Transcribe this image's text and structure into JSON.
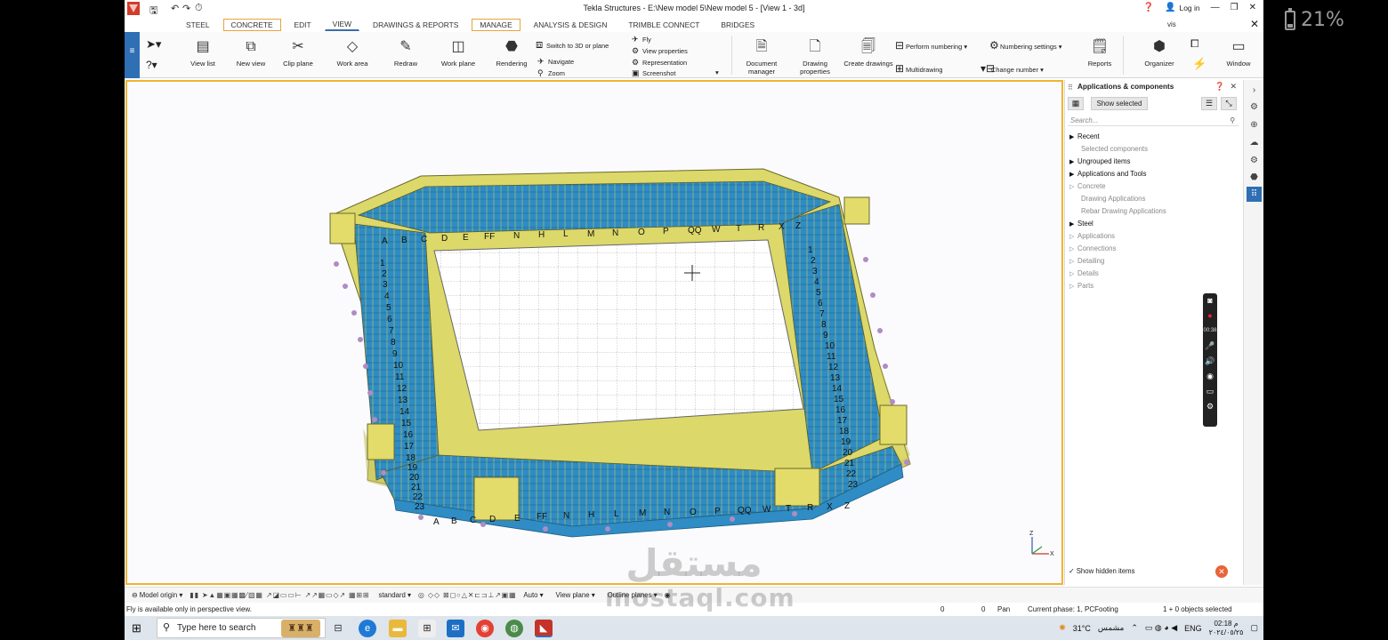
{
  "phone_status": {
    "battery": "21%"
  },
  "window": {
    "title": "Tekla Structures - E:\\New model 5\\New model 5 - [View 1 - 3d]",
    "login": "Log in",
    "search_value": "vis"
  },
  "menu_tabs": [
    {
      "label": "STEEL"
    },
    {
      "label": "CONCRETE"
    },
    {
      "label": "EDIT"
    },
    {
      "label": "VIEW"
    },
    {
      "label": "DRAWINGS & REPORTS"
    },
    {
      "label": "MANAGE"
    },
    {
      "label": "ANALYSIS & DESIGN"
    },
    {
      "label": "TRIMBLE CONNECT"
    },
    {
      "label": "BRIDGES"
    }
  ],
  "ribbon": {
    "view_list": "View list",
    "new_view": "New view",
    "clip_plane": "Clip plane",
    "work_area": "Work area",
    "redraw": "Redraw",
    "work_plane": "Work plane",
    "rendering": "Rendering",
    "switch_3d": "Switch to 3D or plane",
    "navigate": "Navigate",
    "zoom": "Zoom",
    "fly": "Fly",
    "view_properties": "View properties",
    "representation": "Representation",
    "screenshot": "Screenshot",
    "document_manager": "Document manager",
    "drawing_properties": "Drawing properties",
    "create_drawings": "Create drawings",
    "perform_numbering": "Perform numbering",
    "multidrawing": "Multidrawing",
    "numbering_settings": "Numbering settings",
    "change_number": "Change number",
    "reports": "Reports",
    "organizer": "Organizer",
    "window": "Window"
  },
  "model": {
    "grid_x_top": [
      "A",
      "B",
      "C",
      "D",
      "E",
      "FF",
      "N",
      "H",
      "L",
      "M",
      "N",
      "O",
      "P",
      "QQ",
      "W",
      "T",
      "R",
      "X",
      "Z"
    ],
    "grid_x_bottom": [
      "A",
      "B",
      "C",
      "D",
      "E",
      "FF",
      "N",
      "H",
      "L",
      "M",
      "N",
      "O",
      "P",
      "QQ",
      "W",
      "T",
      "R",
      "X",
      "Z"
    ],
    "grid_y": [
      "1",
      "2",
      "3",
      "4",
      "5",
      "6",
      "7",
      "8",
      "9",
      "10",
      "11",
      "12",
      "13",
      "14",
      "15",
      "16",
      "17",
      "18",
      "19",
      "20",
      "21",
      "22",
      "23"
    ]
  },
  "side_panel": {
    "title": "Applications & components",
    "show_selected": "Show selected",
    "search_placeholder": "Search...",
    "tree": [
      {
        "label": "Recent",
        "style": "hdr"
      },
      {
        "label": "Selected components",
        "style": "sub"
      },
      {
        "label": "Ungrouped items",
        "style": "hdr"
      },
      {
        "label": "Applications and Tools",
        "style": "hdr"
      },
      {
        "label": "Concrete",
        "style": "grey"
      },
      {
        "label": "Drawing Applications",
        "style": "sub"
      },
      {
        "label": "Rebar Drawing Applications",
        "style": "sub"
      },
      {
        "label": "Steel",
        "style": "hdr"
      },
      {
        "label": "Applications",
        "style": "grey"
      },
      {
        "label": "Connections",
        "style": "grey"
      },
      {
        "label": "Detailing",
        "style": "grey"
      },
      {
        "label": "Details",
        "style": "grey"
      },
      {
        "label": "Parts",
        "style": "grey"
      }
    ],
    "show_hidden": "Show hidden items"
  },
  "recorder": {
    "time": "00:38"
  },
  "bottom_toolbar": {
    "model_origin": "Model origin",
    "standard": "standard",
    "auto": "Auto",
    "view_plane": "View plane",
    "outline_planes": "Outline planes"
  },
  "status": {
    "message": "Fly is available only in perspective view.",
    "coord_a": "0",
    "coord_b": "0",
    "pan": "Pan",
    "phase": "Current phase: 1, PCFooting",
    "selection": "1 + 0 objects selected"
  },
  "taskbar": {
    "search_placeholder": "Type here to search",
    "temperature": "31°C",
    "weather": "مشمس",
    "language": "ENG",
    "time": "02:18 م",
    "date": "٢٠٢٤/٠٥/٢٥"
  },
  "watermark": {
    "arabic": "مستقل",
    "latin": "mostaql.com"
  },
  "colors": {
    "accent": "#2f6fb4",
    "highlight": "#f0b42e",
    "steel": "#2f8cc4",
    "frame": "#d9d24a",
    "footing": "#b08bc4"
  }
}
